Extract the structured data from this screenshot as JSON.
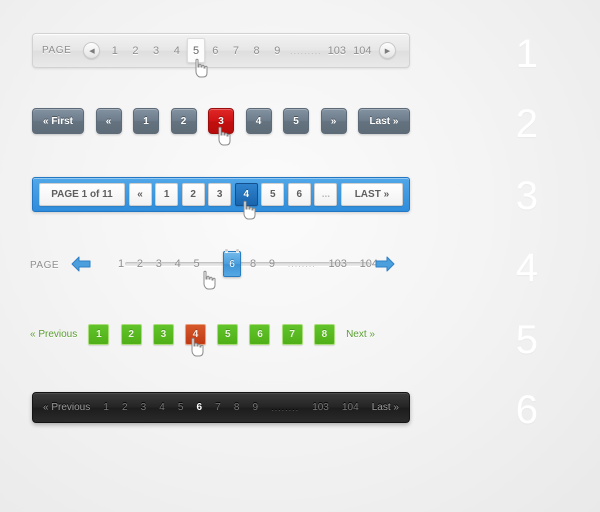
{
  "index_labels": [
    "1",
    "2",
    "3",
    "4",
    "5",
    "6"
  ],
  "row1": {
    "name": "light-inline-pagination",
    "label": "PAGE",
    "prev_icon": "chevron-left-icon",
    "next_icon": "chevron-right-icon",
    "pages": [
      "1",
      "2",
      "3",
      "4",
      "5",
      "6",
      "7",
      "8",
      "9"
    ],
    "ellipsis": ".........",
    "tail_pages": [
      "103",
      "104"
    ],
    "current": "5",
    "cursor_icon": "pointer-hand-cursor"
  },
  "row2": {
    "name": "slate-button-pagination",
    "first_label": "« First",
    "prev_label": "«",
    "pages": [
      "1",
      "2",
      "3",
      "4",
      "5"
    ],
    "next_label": "»",
    "last_label": "Last »",
    "current": "3",
    "active_color": "#cf1414",
    "button_color": "#6e7d8c",
    "cursor_icon": "pointer-hand-cursor"
  },
  "row3": {
    "name": "blue-framed-pagination",
    "page_label": "PAGE 1 of 11",
    "prev_label": "«",
    "pages": [
      "1",
      "2",
      "3",
      "4",
      "5",
      "6"
    ],
    "ellipsis": "...",
    "last_label": "LAST »",
    "current": "4",
    "frame_color": "#2f8ddc",
    "active_color": "#1a64ad",
    "cursor_icon": "pointer-hand-cursor"
  },
  "row4": {
    "name": "slider-track-pagination",
    "label": "PAGE",
    "prev_icon": "arrow-left-icon",
    "next_icon": "arrow-right-icon",
    "pages": [
      "1",
      "2",
      "3",
      "4",
      "5",
      "6",
      "7",
      "8",
      "9"
    ],
    "ellipsis": "........",
    "tail_pages": [
      "103",
      "104"
    ],
    "current": "6",
    "arrow_color": "#3d90d4",
    "handle_color": "#4b9fdd",
    "cursor_icon": "pointer-hand-cursor"
  },
  "row5": {
    "name": "green-square-pagination",
    "prev_label": "« Previous",
    "next_label": "Next »",
    "pages": [
      "1",
      "2",
      "3",
      "4",
      "5",
      "6",
      "7",
      "8"
    ],
    "current": "4",
    "square_color": "#4faf18",
    "active_color": "#bf3a14",
    "link_color": "#5a9e30",
    "cursor_icon": "pointer-hand-cursor"
  },
  "row6": {
    "name": "dark-bar-pagination",
    "prev_label": "« Previous",
    "pages": [
      "1",
      "2",
      "3",
      "4",
      "5",
      "6",
      "7",
      "8",
      "9"
    ],
    "ellipsis": "........",
    "tail_pages": [
      "103",
      "104"
    ],
    "last_label": "Last »",
    "current": "6",
    "bar_color": "#242424"
  }
}
